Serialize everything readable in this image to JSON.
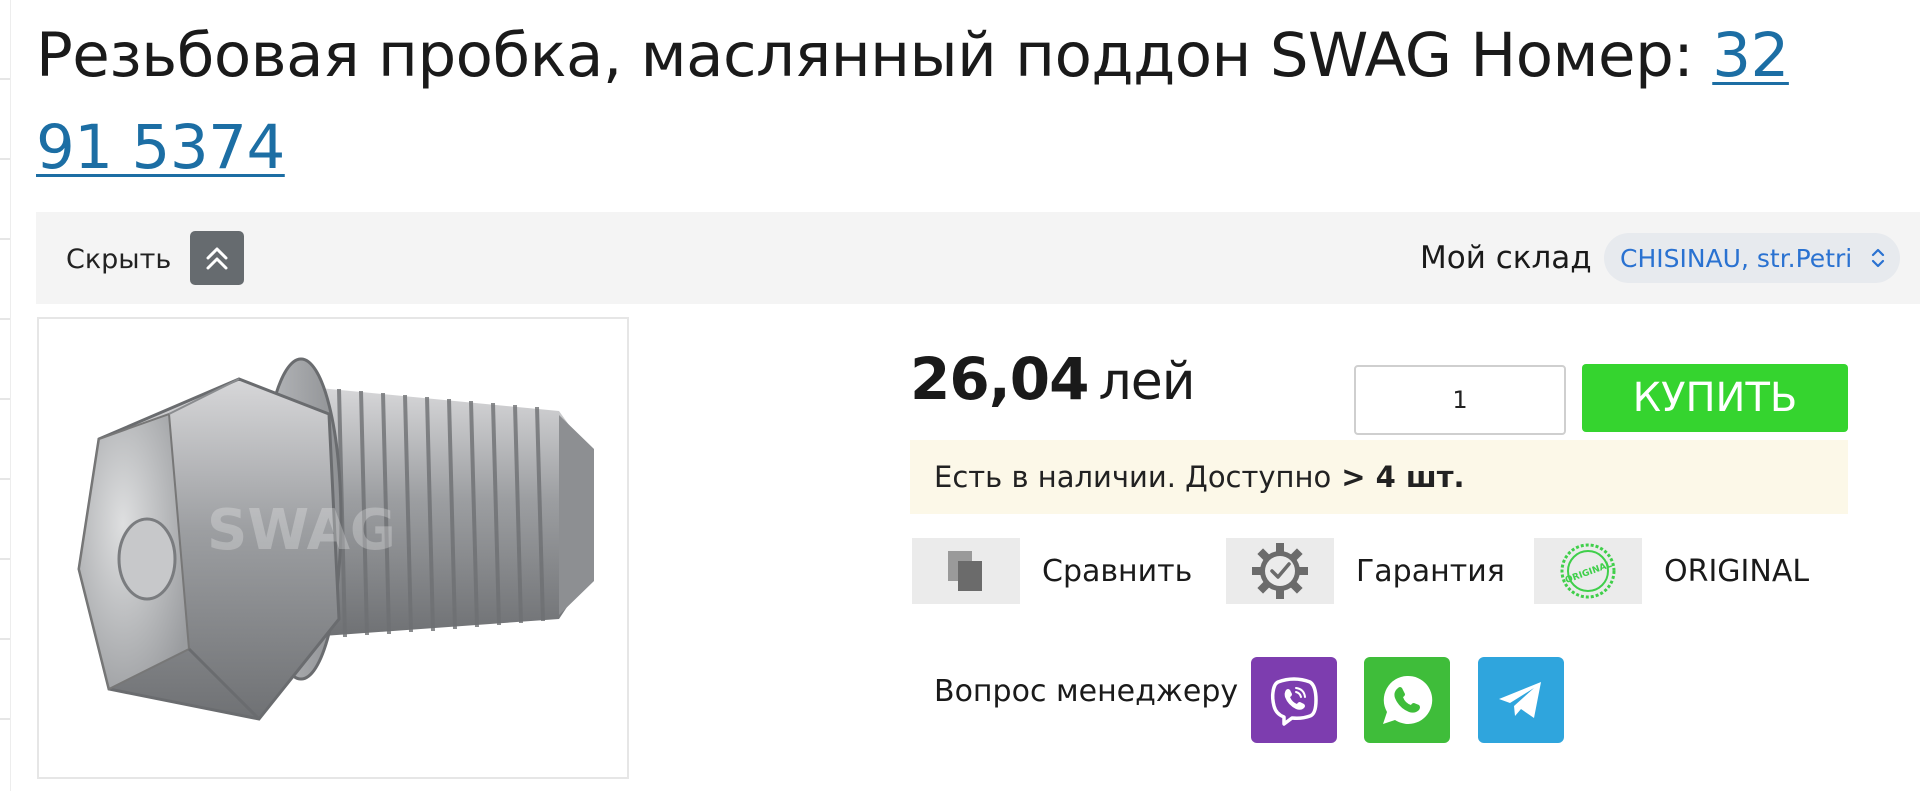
{
  "header": {
    "title_text": "Резьбовая пробка, маслянный поддон SWAG Номер: ",
    "part_number": "32 91 5374"
  },
  "toolbar": {
    "hide_label": "Скрыть",
    "hide_icon": "double-chevron-up-icon",
    "warehouse_label": "Мой склад",
    "warehouse_value": "CHISINAU, str.Petri"
  },
  "product": {
    "image_alt": "SWAG",
    "price_value": "26,04",
    "price_currency": "лей",
    "quantity": "1",
    "buy_label": "КУПИТЬ",
    "stock_text": "Есть в наличии. Доступно",
    "stock_count": "> 4 шт."
  },
  "features": {
    "compare_label": "Сравнить",
    "warranty_label": "Гарантия",
    "original_label": "ORIGINAL",
    "original_stamp": "ORIGINAL"
  },
  "contact": {
    "question_label": "Вопрос менеджеру",
    "viber_icon": "viber-icon",
    "whatsapp_icon": "whatsapp-icon",
    "telegram_icon": "telegram-icon"
  },
  "colors": {
    "link": "#1c6ea4",
    "buy_button": "#35d42f",
    "warehouse_text": "#2a72d1",
    "stock_bg": "#fcf8e8",
    "viber": "#7d3daf",
    "whatsapp": "#3fbd3a",
    "telegram": "#2fa5dd"
  }
}
